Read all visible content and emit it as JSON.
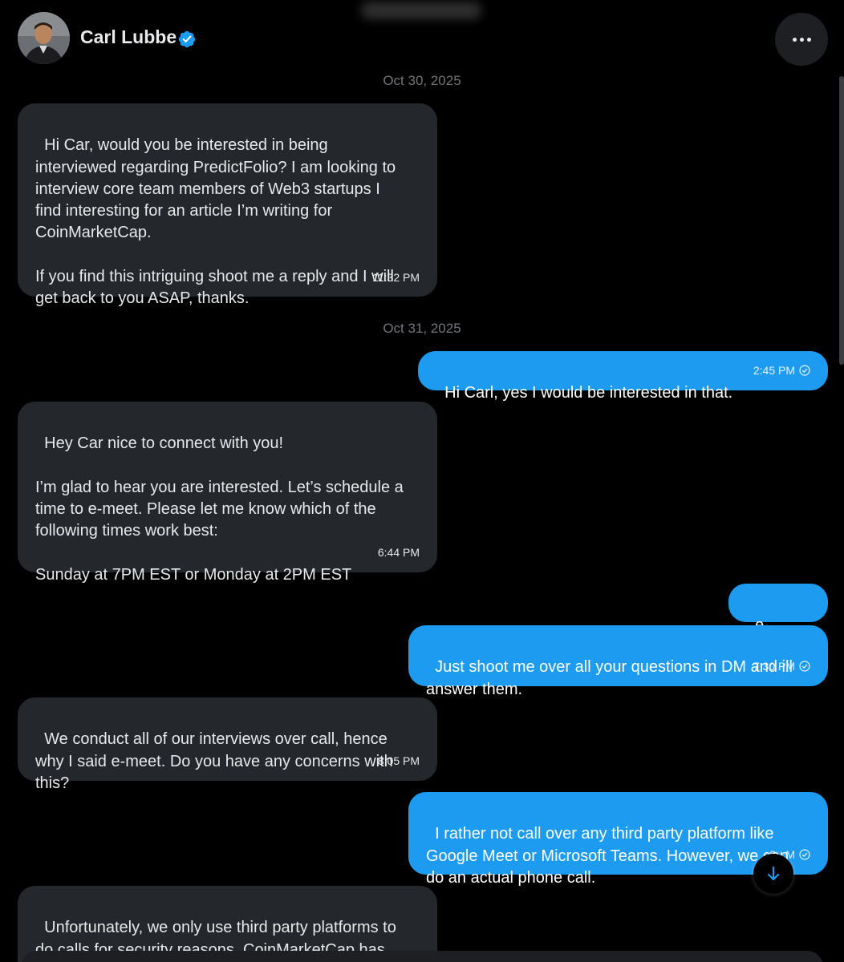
{
  "header": {
    "name": "Carl Lubbe",
    "verified_icon": "verified-badge-icon",
    "more_icon": "more-horizontal-icon"
  },
  "colors": {
    "background": "#000000",
    "incoming_bubble": "#24272b",
    "outgoing_bubble": "#1d9bf0",
    "verified": "#1d9bf0",
    "muted_text": "#71767b"
  },
  "dates": [
    "Oct 30, 2025",
    "Oct 31, 2025"
  ],
  "messages": [
    {
      "direction": "in",
      "text": "Hi Car, would you be interested in being\ninterviewed regarding PredictFolio? I am looking to\ninterview core team members of Web3 startups I\nfind interesting for an article I’m writing for\nCoinMarketCap.\n\nIf you find this intriguing shoot me a reply and I will\nget back to you ASAP, thanks.",
      "time": "11:32 PM"
    },
    {
      "direction": "out",
      "text": "Hi Carl, yes I would be interested in that.",
      "time": "2:45 PM"
    },
    {
      "direction": "in",
      "text": "Hey Car nice to connect with you!\n\nI’m glad to hear you are interested. Let’s schedule a\ntime to e-meet. Please let me know which of the\nfollowing times work best:\n\nSunday at 7PM EST or Monday at 2PM EST",
      "time": "6:44 PM"
    },
    {
      "direction": "out",
      "text": "e-meet?",
      "time": ""
    },
    {
      "direction": "out",
      "text": "Just shoot me over all your questions in DM and ill\nanswer them.",
      "time": "7:30 PM"
    },
    {
      "direction": "in",
      "text": "We conduct all of our interviews over call, hence\nwhy I said e-meet. Do you have any concerns with\nthis?",
      "time": "8:05 PM"
    },
    {
      "direction": "out",
      "text": "I rather not call over any third party platform like\nGoogle Meet or Microsoft Teams. However, we can\ndo an actual phone call.",
      "time": "8:   M"
    },
    {
      "direction": "in",
      "text": "Unfortunately, we only use third party platforms to\ndo calls for security reasons. CoinMarketCap has\nhad a lot of issues with SIM Swap Attacks in recent",
      "time": ""
    }
  ],
  "scroll_down_icon": "arrow-down-icon"
}
